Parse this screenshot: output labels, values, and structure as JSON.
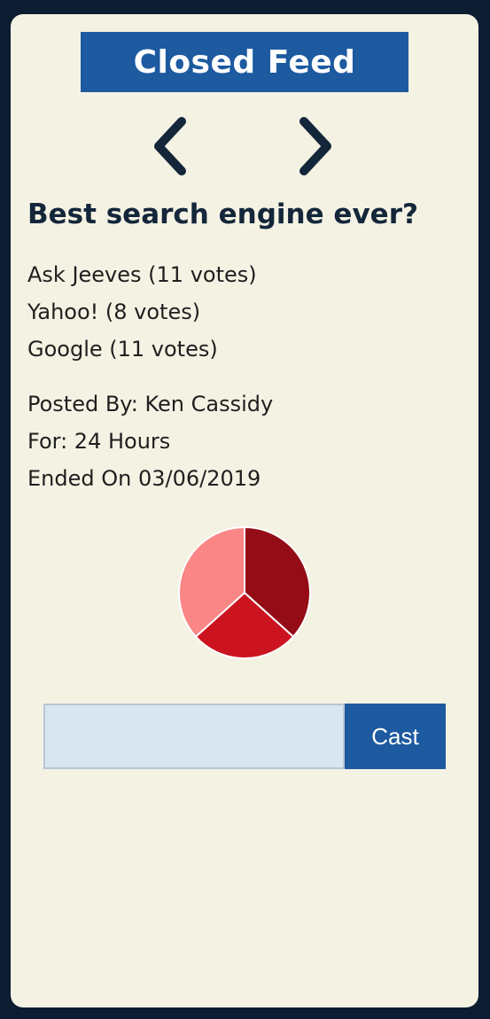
{
  "header": {
    "title": "Closed Feed"
  },
  "nav": {
    "prev_icon": "chevron-left-icon",
    "next_icon": "chevron-right-icon",
    "icon_color": "#14263a"
  },
  "poll": {
    "question": "Best search engine ever?",
    "options": [
      {
        "label": "Ask Jeeves (11 votes)",
        "name": "Ask Jeeves",
        "votes": 11
      },
      {
        "label": "Yahoo! (8 votes)",
        "name": "Yahoo!",
        "votes": 8
      },
      {
        "label": "Google (11 votes)",
        "name": "Google",
        "votes": 11
      }
    ],
    "posted_by": "Posted By: Ken Cassidy",
    "duration": "For: 24 Hours",
    "ended_on": "Ended On 03/06/2019"
  },
  "chart_data": {
    "type": "pie",
    "categories": [
      "Ask Jeeves",
      "Yahoo!",
      "Google"
    ],
    "values": [
      11,
      8,
      11
    ],
    "colors": [
      "#930c16",
      "#cb1420",
      "#fb8686"
    ]
  },
  "vote": {
    "input_value": "",
    "input_placeholder": "",
    "cast_label": "Cast"
  },
  "colors": {
    "background": "#0c1d31",
    "card": "#f4f2e3",
    "accent": "#1d5aa0"
  }
}
